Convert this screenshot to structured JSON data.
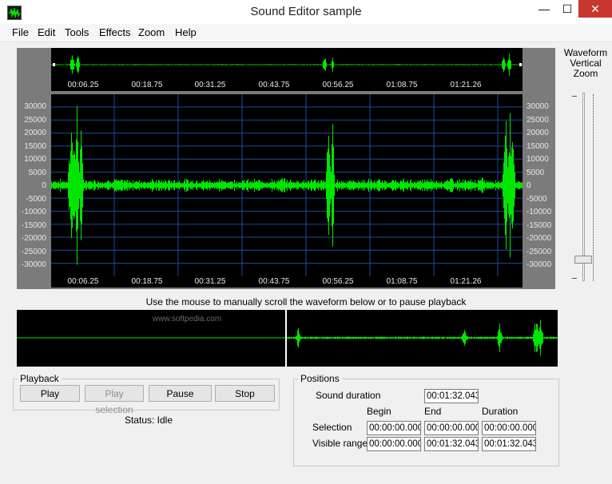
{
  "window": {
    "title": "Sound Editor sample",
    "minimize_glyph": "—",
    "maximize_glyph": "☐",
    "close_glyph": "✕"
  },
  "menu": [
    "File",
    "Edit",
    "Tools",
    "Effects",
    "Zoom",
    "Help"
  ],
  "timeline": {
    "labels": [
      "00:06.25",
      "00:18.75",
      "00:31.25",
      "00:43.75",
      "00:56.25",
      "01:08.75",
      "01:21.26"
    ]
  },
  "amplitude_labels": [
    "30000",
    "25000",
    "20000",
    "15000",
    "10000",
    "5000",
    "0",
    "-5000",
    "-10000",
    "-15000",
    "-20000",
    "-25000",
    "-30000"
  ],
  "zoom_panel": {
    "label_line1": "Waveform",
    "label_line2": "Vertical",
    "label_line3": "Zoom"
  },
  "scroll_hint": "Use the mouse to manually scroll the waveform below or to pause playback",
  "watermark": "www.softpedia.com",
  "playback": {
    "title": "Playback",
    "play": "Play",
    "play_selection": "Play selection",
    "pause": "Pause",
    "stop": "Stop",
    "status": "Status: Idle"
  },
  "positions": {
    "title": "Positions",
    "sound_duration_label": "Sound duration",
    "sound_duration_value": "00:01:32.043",
    "col_begin": "Begin",
    "col_end": "End",
    "col_duration": "Duration",
    "selection_label": "Selection",
    "selection_begin": "00:00:00.000",
    "selection_end": "00:00:00.000",
    "selection_duration": "00:00:00.000",
    "visible_label": "Visible range",
    "visible_begin": "00:00:00.000",
    "visible_end": "00:01:32.043",
    "visible_duration": "00:01:32.043"
  },
  "colors": {
    "waveform": "#00e600",
    "background": "#000000",
    "grid": "#1a4a9a",
    "close_button": "#c7372f"
  }
}
